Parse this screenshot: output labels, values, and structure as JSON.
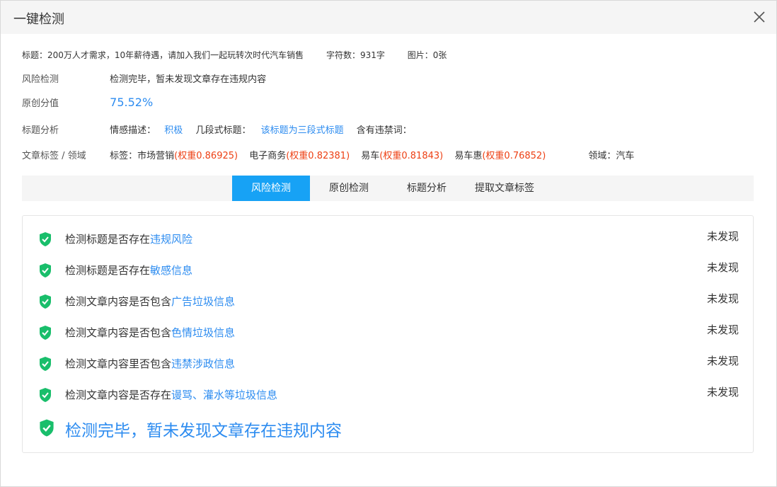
{
  "dialog": {
    "title": "一键检测"
  },
  "meta": {
    "headline": "标题：200万人才需求，10年薪待遇，请加入我们一起玩转次时代汽车销售",
    "char_count": "字符数：931字",
    "images": "图片：0张"
  },
  "risk": {
    "label": "风险检测",
    "value": "检测完毕，暂未发现文章存在违规内容"
  },
  "original": {
    "label": "原创分值",
    "value": "75.52%"
  },
  "title_analysis": {
    "label": "标题分析",
    "emotion_label": "情感描述：",
    "emotion_value": "积极",
    "segment_label": "几段式标题：",
    "segment_value": "该标题为三段式标题",
    "forbidden_label": "含有违禁词："
  },
  "tags": {
    "label": "文章标签 / 领域",
    "prefix": "标签：",
    "items": [
      {
        "name": "市场营销",
        "weight": "(权重0.86925)"
      },
      {
        "name": "电子商务",
        "weight": "(权重0.82381)"
      },
      {
        "name": "易车",
        "weight": "(权重0.81843)"
      },
      {
        "name": "易车惠",
        "weight": "(权重0.76852)"
      }
    ],
    "domain": "领域：汽车"
  },
  "tabs": [
    {
      "label": "风险检测",
      "active": true
    },
    {
      "label": "原创检测",
      "active": false
    },
    {
      "label": "标题分析",
      "active": false
    },
    {
      "label": "提取文章标签",
      "active": false
    }
  ],
  "checks": [
    {
      "prefix": "检测标题是否存在",
      "highlight": "违规风险",
      "status": "未发现"
    },
    {
      "prefix": "检测标题是否存在",
      "highlight": "敏感信息",
      "status": "未发现"
    },
    {
      "prefix": "检测文章内容是否包含",
      "highlight": "广告垃圾信息",
      "status": "未发现"
    },
    {
      "prefix": "检测文章内容是否包含",
      "highlight": "色情垃圾信息",
      "status": "未发现"
    },
    {
      "prefix": "检测文章内容里否包含",
      "highlight": "违禁涉政信息",
      "status": "未发现"
    },
    {
      "prefix": "检测文章内容是否存在",
      "highlight": "谩骂、灌水等垃圾信息",
      "status": "未发现"
    }
  ],
  "final_result": "检测完毕，暂未发现文章存在违规内容",
  "colors": {
    "accent": "#2d8cf0",
    "tab_active": "#17a2f5",
    "shield": "#19be6b",
    "weight": "#ed4014"
  }
}
